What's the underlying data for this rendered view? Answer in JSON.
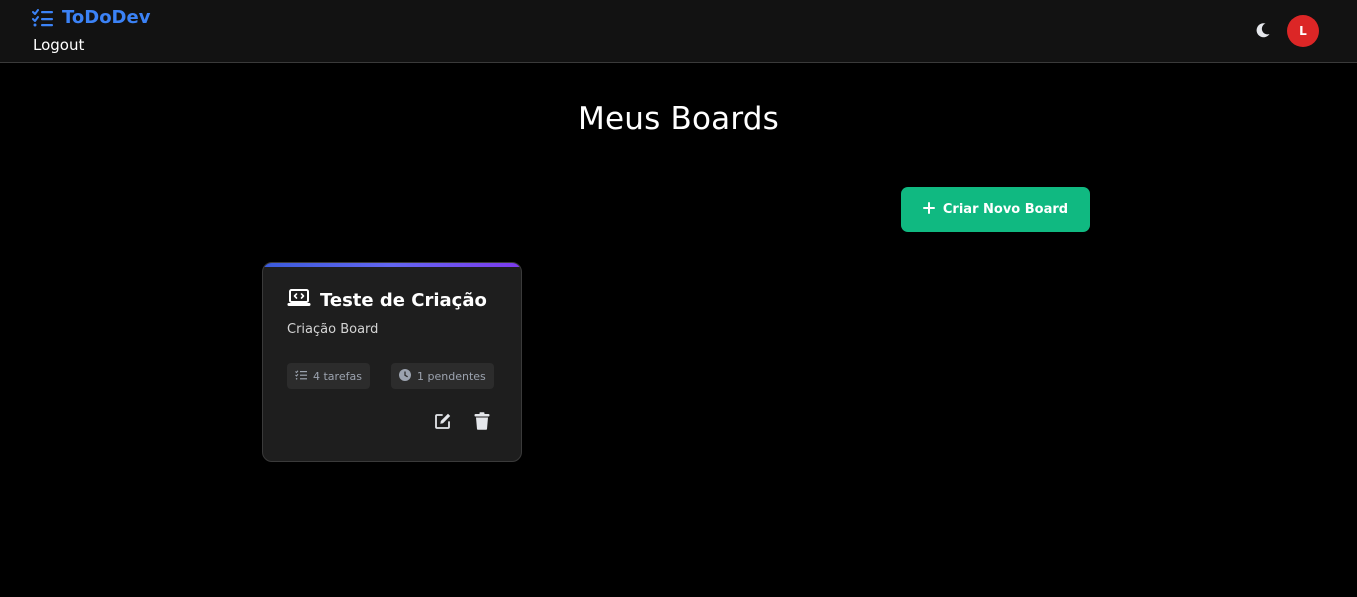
{
  "header": {
    "brand": "ToDoDev",
    "brand_icon": "tasks-list-icon",
    "logout_label": "Logout",
    "theme_icon": "moon-icon",
    "avatar_initial": "L",
    "avatar_color": "#dc2626"
  },
  "main": {
    "title": "Meus Boards",
    "create_button_label": "Criar Novo Board",
    "create_button_icon": "plus-icon",
    "accent_color": "#10b981"
  },
  "boards": [
    {
      "icon": "laptop-code-icon",
      "title": "Teste de Criação",
      "description": "Criação Board",
      "tasks_label": "4 tarefas",
      "pending_label": "1 pendentes",
      "edit_icon": "edit-icon",
      "delete_icon": "trash-icon"
    }
  ]
}
